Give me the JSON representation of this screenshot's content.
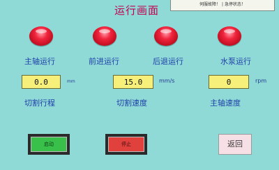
{
  "title": "运行画面",
  "status": {
    "left": "伺服故障！",
    "sep": "|",
    "right": "急停状态！"
  },
  "lamps": [
    {
      "label": "主轴运行",
      "icon": "red-indicator-lamp"
    },
    {
      "label": "前进运行",
      "icon": "red-indicator-lamp"
    },
    {
      "label": "后退运行",
      "icon": "red-indicator-lamp"
    },
    {
      "label": "水泵运行",
      "icon": "red-indicator-lamp"
    }
  ],
  "readouts": [
    {
      "value": "0.0",
      "unit": "mm",
      "label": "切割行程"
    },
    {
      "value": "15.0",
      "unit": "mm/s",
      "label": "切割速度"
    },
    {
      "value": "0",
      "unit": "rpm",
      "label": "主轴速度"
    }
  ],
  "buttons": {
    "start": "启动",
    "stop": "停止",
    "back": "返回"
  },
  "colors": {
    "background": "#8fd9d6",
    "lamp_on": "#e8142c",
    "value_box": "#f6f07a",
    "start": "#39c04b",
    "stop": "#e0413c"
  }
}
